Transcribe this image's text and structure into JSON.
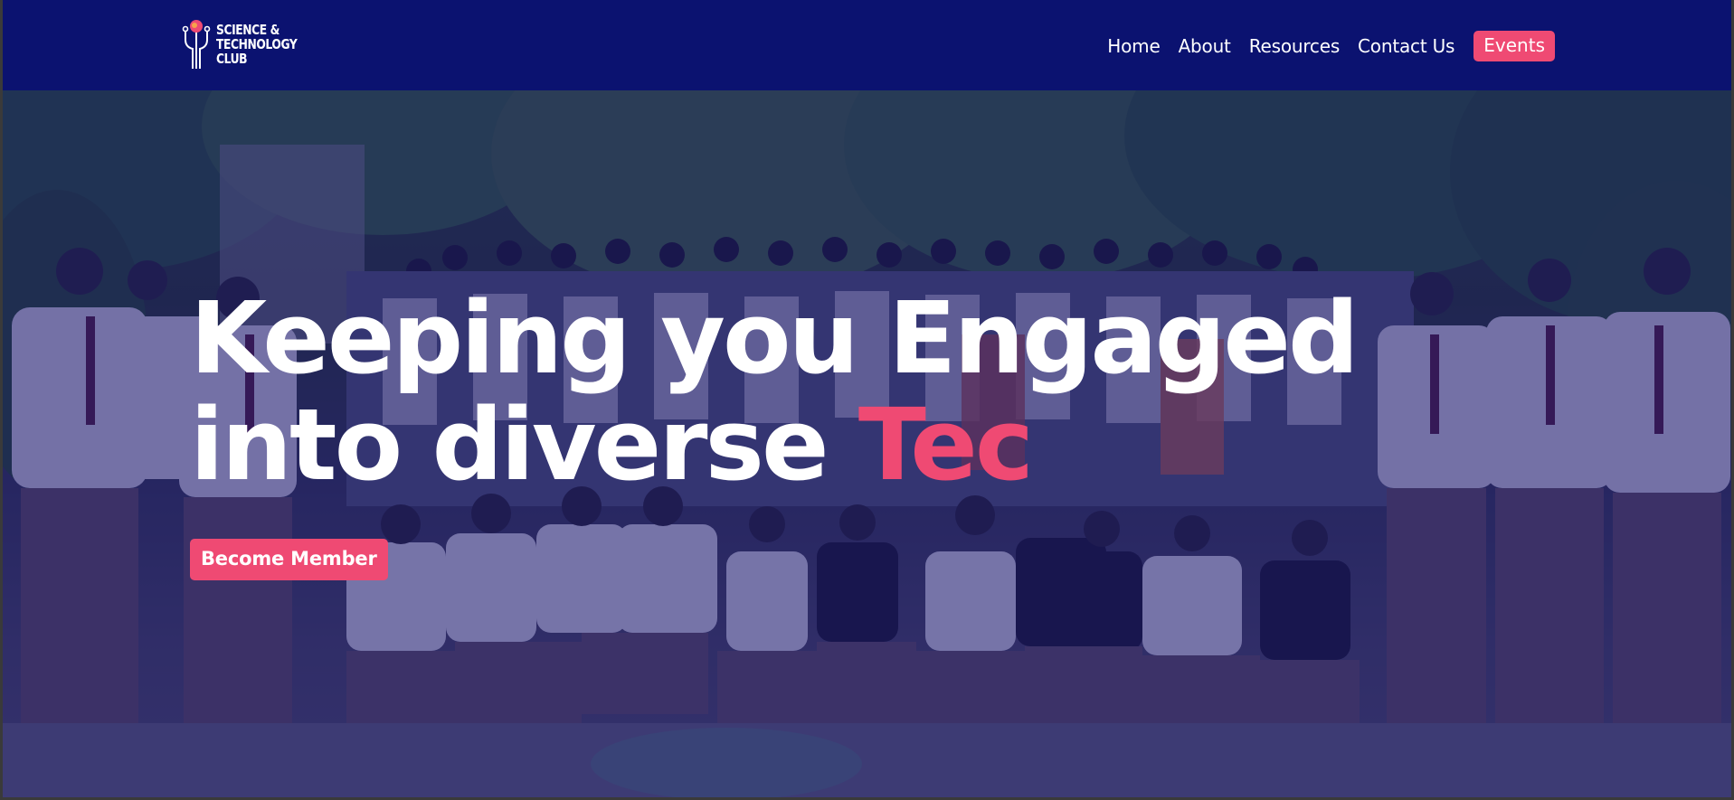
{
  "nav": {
    "logo_lines": [
      "SCIENCE &",
      "TECHNOLOGY",
      "CLUB"
    ],
    "links": [
      "Home",
      "About",
      "Resources",
      "Contact Us"
    ],
    "events_label": "Events",
    "colors": {
      "background": "#0b1270",
      "accent": "#ef4a73",
      "text": "#ffffff"
    }
  },
  "hero": {
    "headline_line1": "Keeping you Engaged",
    "headline_line2_prefix": "into diverse ",
    "headline_line2_accent": "Tec",
    "cta_label": "Become Member",
    "background_image": "group photo of club members in white shirts and ties outdoors under trees",
    "overlay_color": "#16146e"
  }
}
